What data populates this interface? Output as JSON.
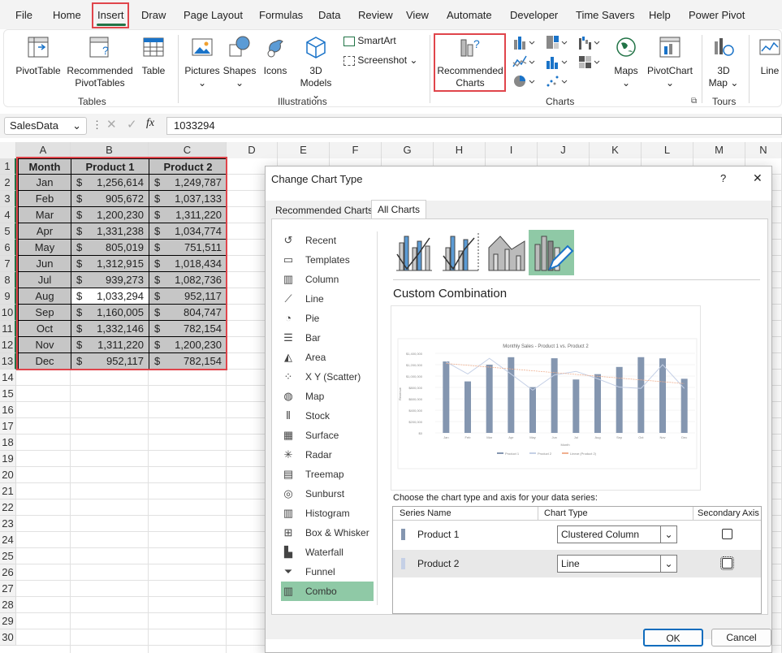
{
  "menu": {
    "file": "File",
    "home": "Home",
    "insert": "Insert",
    "draw": "Draw",
    "page_layout": "Page Layout",
    "formulas": "Formulas",
    "data": "Data",
    "review": "Review",
    "view": "View",
    "automate": "Automate",
    "developer": "Developer",
    "time_savers": "Time Savers",
    "help": "Help",
    "power_pivot": "Power Pivot"
  },
  "ribbon": {
    "pivottable": "PivotTable",
    "rec_pivot_1": "Recommended",
    "rec_pivot_2": "PivotTables",
    "table": "Table",
    "tables_group": "Tables",
    "pictures": "Pictures",
    "shapes": "Shapes",
    "icons": "Icons",
    "models_1": "3D",
    "models_2": "Models",
    "smartart": "SmartArt",
    "screenshot": "Screenshot",
    "illustrations_group": "Illustrations",
    "rec_charts_1": "Recommended",
    "rec_charts_2": "Charts",
    "maps": "Maps",
    "pivotchart": "PivotChart",
    "charts_group": "Charts",
    "map3d_1": "3D",
    "map3d_2": "Map",
    "tours_group": "Tours",
    "line": "Line"
  },
  "formula": {
    "name_box": "SalesData",
    "fx": "fx",
    "value": "1033294"
  },
  "columns": [
    "A",
    "B",
    "C",
    "D",
    "E",
    "F",
    "G",
    "H",
    "I",
    "J",
    "K",
    "L",
    "M",
    "N"
  ],
  "rows": [
    "1",
    "2",
    "3",
    "4",
    "5",
    "6",
    "7",
    "8",
    "9",
    "10",
    "11",
    "12",
    "13",
    "14",
    "15",
    "16",
    "17",
    "18",
    "19",
    "20",
    "21",
    "22",
    "23",
    "24",
    "25",
    "26",
    "27",
    "28",
    "29",
    "30"
  ],
  "table": {
    "headers": [
      "Month",
      "Product 1",
      "Product 2"
    ],
    "currency": "$",
    "rows": [
      [
        "Jan",
        "1,256,614",
        "1,249,787"
      ],
      [
        "Feb",
        "905,672",
        "1,037,133"
      ],
      [
        "Mar",
        "1,200,230",
        "1,311,220"
      ],
      [
        "Apr",
        "1,331,238",
        "1,034,774"
      ],
      [
        "May",
        "805,019",
        "751,511"
      ],
      [
        "Jun",
        "1,312,915",
        "1,018,434"
      ],
      [
        "Jul",
        "939,273",
        "1,082,736"
      ],
      [
        "Aug",
        "1,033,294",
        "952,117"
      ],
      [
        "Sep",
        "1,160,005",
        "804,747"
      ],
      [
        "Oct",
        "1,332,146",
        "782,154"
      ],
      [
        "Nov",
        "1,311,220",
        "1,200,230"
      ],
      [
        "Dec",
        "952,117",
        "782,154"
      ]
    ]
  },
  "dialog": {
    "title": "Change Chart Type",
    "help": "?",
    "close": "✕",
    "tab_recommended": "Recommended Charts",
    "tab_all": "All Charts",
    "chart_types": [
      "Recent",
      "Templates",
      "Column",
      "Line",
      "Pie",
      "Bar",
      "Area",
      "X Y (Scatter)",
      "Map",
      "Stock",
      "Surface",
      "Radar",
      "Treemap",
      "Sunburst",
      "Histogram",
      "Box & Whisker",
      "Waterfall",
      "Funnel",
      "Combo"
    ],
    "selected_type": "Combo",
    "combo_title": "Custom Combination",
    "preview": {
      "title": "Monthly Sales - Product 1 vs. Product 2",
      "ylabel": "Revenue",
      "xlabel": "Month",
      "legend": [
        "Product 1",
        "Product 2",
        "Linear (Product 2)"
      ],
      "yticks": [
        "$1,400,000",
        "$1,200,000",
        "$1,000,000",
        "$800,000",
        "$600,000",
        "$400,000",
        "$200,000",
        "$0"
      ]
    },
    "series_prompt": "Choose the chart type and axis for your data series:",
    "series_headers": {
      "name": "Series Name",
      "type": "Chart Type",
      "secondary": "Secondary Axis"
    },
    "series": [
      {
        "name": "Product 1",
        "type": "Clustered Column",
        "color": "#8496b0"
      },
      {
        "name": "Product 2",
        "type": "Line",
        "color": "#c5d0e6"
      }
    ],
    "ok": "OK",
    "cancel": "Cancel"
  },
  "colors": {
    "accent": "#217346",
    "highlight": "#e0454b",
    "selected": "#8fc9a6"
  }
}
